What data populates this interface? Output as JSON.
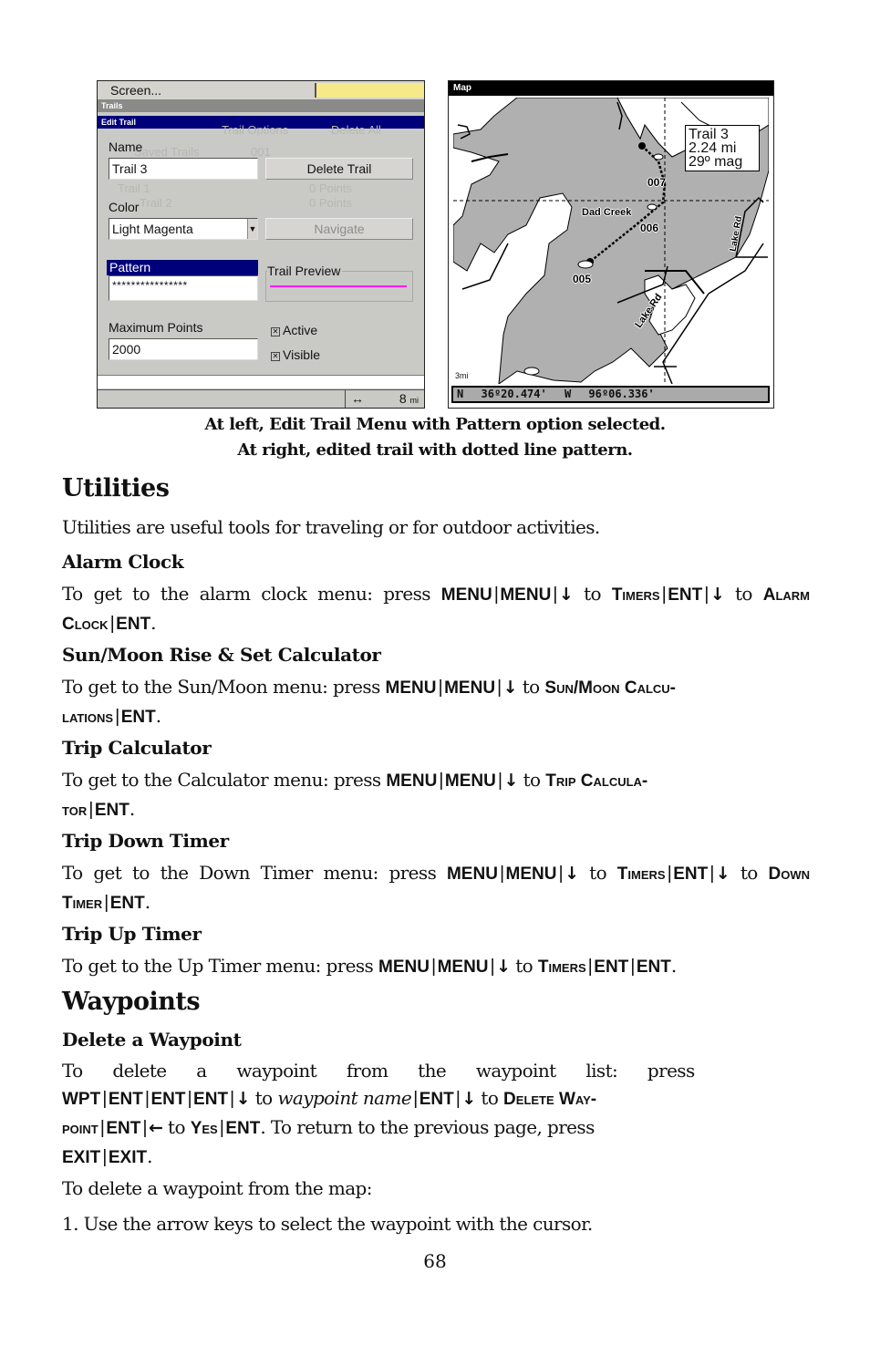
{
  "left_screenshot": {
    "top_menu": "Screen...",
    "breadcrumb_1": "Trails",
    "breadcrumb_2": "Edit Trail",
    "ghost_bg_text": [
      "Trail Options",
      "Delete All",
      "Saved Trails",
      "001",
      "Trail 1",
      "0 Points",
      "Trail 2",
      "0 Points"
    ],
    "name_label": "Name",
    "name_value": "Trail 3",
    "delete_trail_button": "Delete Trail",
    "color_label": "Color",
    "color_value": "Light Magenta",
    "navigate_button": "Navigate",
    "pattern_label": "Pattern",
    "pattern_value": "****************",
    "trail_preview_label": "Trail Preview",
    "trail_preview_color": "#ff1aff",
    "max_points_label": "Maximum Points",
    "max_points_value": "2000",
    "active_label": "Active",
    "active_checked": true,
    "visible_label": "Visible",
    "visible_checked": true,
    "status_arrow": "↔",
    "status_distance": "8",
    "status_unit": "mi"
  },
  "right_screenshot": {
    "title": "Map",
    "info_box": [
      "Trail 3",
      "2.24 mi",
      "29º mag"
    ],
    "waypoints": [
      "007",
      "006",
      "005"
    ],
    "place_label": "Dad Creek",
    "road_label": "Lake Rd",
    "scale_label": "3mi",
    "lat_hemisphere": "N",
    "latitude": "36º20.474'",
    "lon_hemisphere": "W",
    "longitude": "96º06.336'"
  },
  "caption": {
    "line1": "At left, Edit Trail Menu with Pattern option selected.",
    "line2": "At right, edited trail with dotted line pattern."
  },
  "utilities": {
    "heading": "Utilities",
    "intro": "Utilities are useful tools for traveling or for outdoor activities.",
    "alarm_clock": {
      "heading": "Alarm Clock",
      "text_prefix": "To get to the alarm clock menu: press",
      "k1": "MENU",
      "k2": "MENU",
      "to": "to",
      "menu_item_1": "Timers",
      "k3": "ENT",
      "menu_item_2": "Alarm Clock",
      "k4": "ENT"
    },
    "sun_moon": {
      "heading": "Sun/Moon Rise & Set Calculator",
      "text_prefix": "To get to the Sun/Moon menu: press",
      "k1": "MENU",
      "k2": "MENU",
      "to": "to",
      "menu_item_a": "Sun/Moon Calcu-",
      "menu_item_b": "lations",
      "k3": "ENT"
    },
    "trip_calculator": {
      "heading": "Trip Calculator",
      "text_prefix": "To get to the Calculator menu: press",
      "k1": "MENU",
      "k2": "MENU",
      "to": "to",
      "menu_item_a": "Trip Calcula-",
      "menu_item_b": "tor",
      "k3": "ENT"
    },
    "trip_down_timer": {
      "heading": "Trip Down Timer",
      "text_prefix": "To get to the Down Timer menu: press",
      "k1": "MENU",
      "k2": "MENU",
      "to": "to",
      "menu_item_1": "Timers",
      "k3": "ENT",
      "menu_item_2": "Down Timer",
      "k4": "ENT"
    },
    "trip_up_timer": {
      "heading": "Trip Up Timer",
      "text_prefix": "To get to the Up Timer menu: press",
      "k1": "MENU",
      "k2": "MENU",
      "to": "to",
      "menu_item_1": "Timers",
      "k3": "ENT",
      "k4": "ENT"
    }
  },
  "waypoints": {
    "heading": "Waypoints",
    "delete": {
      "heading": "Delete a Waypoint",
      "text_prefix": "To delete a waypoint from the waypoint list: press",
      "k_wpt": "WPT",
      "k_ent": "ENT",
      "to": "to",
      "waypoint_name": "waypoint name",
      "menu_item_a": "Delete Way-",
      "menu_item_b": "point",
      "yes": "Yes",
      "return_text": "To return to the previous page, press",
      "k_exit": "EXIT",
      "map_intro": "To delete a waypoint from the map:",
      "step1": "1. Use the arrow keys to select the waypoint with the cursor."
    }
  },
  "page_number": "68"
}
